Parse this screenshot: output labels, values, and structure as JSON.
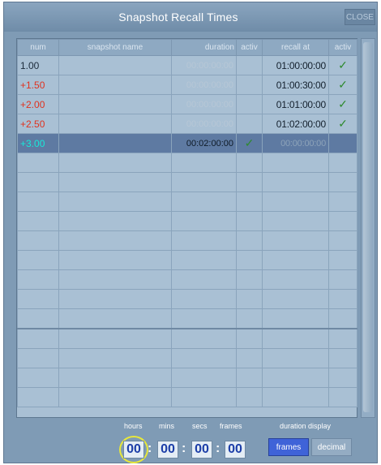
{
  "window": {
    "title": "Snapshot Recall Times",
    "close_label": "CLOSE"
  },
  "table": {
    "headers": {
      "num": "num",
      "name": "snapshot name",
      "duration": "duration",
      "dur_active": "activ",
      "recall": "recall at",
      "rec_active": "activ"
    },
    "rows": [
      {
        "num": "1.00",
        "name": "",
        "duration": "00:00:00:00",
        "dur_active": "",
        "recall": "01:00:00:00",
        "rec_active": "✓"
      },
      {
        "num": "+1.50",
        "name": "",
        "duration": "00:00:00:00",
        "dur_active": "",
        "recall": "01:00:30:00",
        "rec_active": "✓"
      },
      {
        "num": "+2.00",
        "name": "",
        "duration": "00:00:00:00",
        "dur_active": "",
        "recall": "01:01:00:00",
        "rec_active": "✓"
      },
      {
        "num": "+2.50",
        "name": "",
        "duration": "00:00:00:00",
        "dur_active": "",
        "recall": "01:02:00:00",
        "rec_active": "✓"
      },
      {
        "num": "+3.00",
        "name": "",
        "duration": "00:02:00:00",
        "dur_active": "✓",
        "recall": "00:00:00:00",
        "rec_active": ""
      }
    ]
  },
  "timecode": {
    "labels": {
      "hours": "hours",
      "mins": "mins",
      "secs": "secs",
      "frames": "frames"
    },
    "values": {
      "hours": "00",
      "mins": "00",
      "secs": "00",
      "frames": "00"
    },
    "separator": ":"
  },
  "duration_display": {
    "label": "duration display",
    "frames": "frames",
    "decimal": "decimal",
    "selected": "frames"
  },
  "colors": {
    "accent": "#3f63d8",
    "highlight": "#e8e83a",
    "check": "#2e8a2e",
    "plus_num": "#e0321f",
    "selected_num": "#18e8d9"
  }
}
